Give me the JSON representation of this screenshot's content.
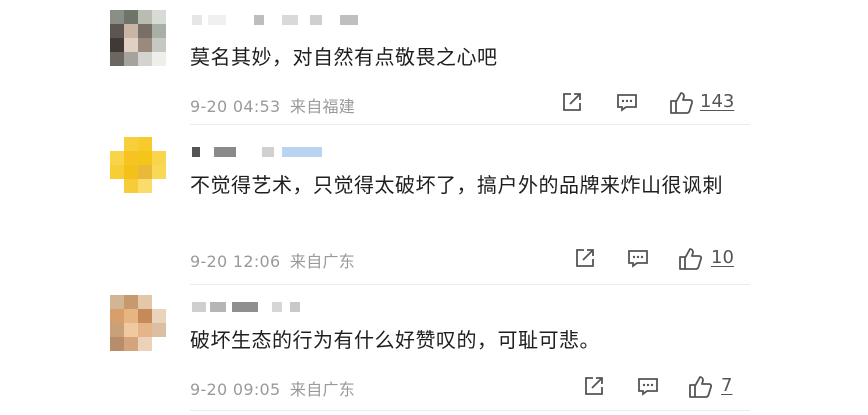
{
  "comments": [
    {
      "text": "莫名其妙，对自然有点敬畏之心吧",
      "time": "9-20 04:53",
      "location": "来自福建",
      "likes": "143",
      "share_icon": "share-icon",
      "reply_icon": "comment-icon",
      "like_icon": "thumbs-up-icon"
    },
    {
      "text": "不觉得艺术，只觉得太破坏了，搞户外的品牌来炸山很讽刺",
      "time": "9-20 12:06",
      "location": "来自广东",
      "likes": "10",
      "share_icon": "share-icon",
      "reply_icon": "comment-icon",
      "like_icon": "thumbs-up-icon"
    },
    {
      "text": "破坏生态的行为有什么好赞叹的，可耻可悲。",
      "time": "9-20 09:05",
      "location": "来自广东",
      "likes": "7",
      "share_icon": "share-icon",
      "reply_icon": "comment-icon",
      "like_icon": "thumbs-up-icon"
    }
  ]
}
